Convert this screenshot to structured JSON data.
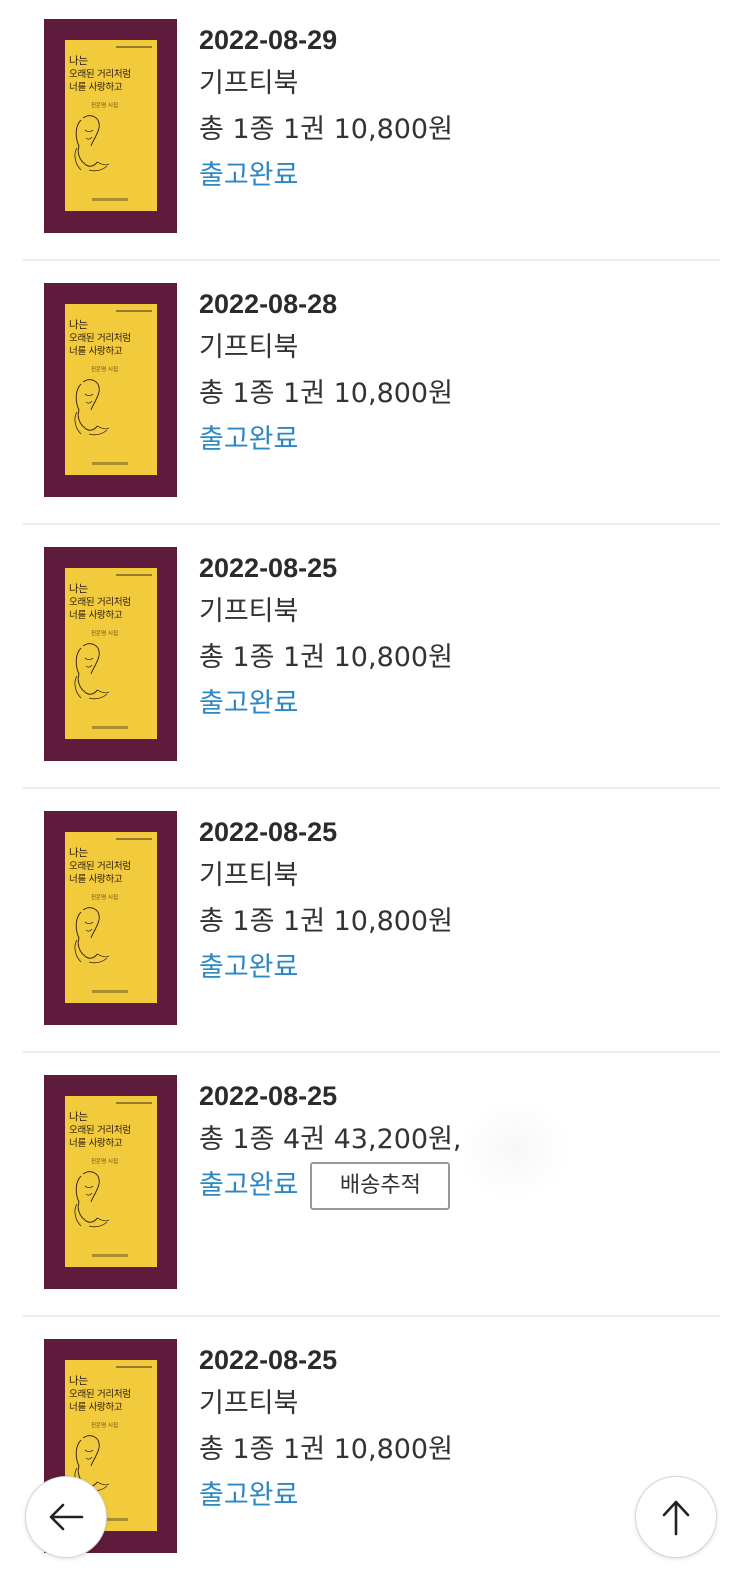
{
  "book": {
    "cover_title_line1": "나는",
    "cover_title_line2": "오래된 거리처럼",
    "cover_title_line3": "너를 사랑하고",
    "cover_author": "진은영 시집"
  },
  "orders": [
    {
      "date": "2022-08-29",
      "product": "기프티북",
      "summary": "총 1종 1권 10,800원",
      "status": "출고완료"
    },
    {
      "date": "2022-08-28",
      "product": "기프티북",
      "summary": "총 1종 1권 10,800원",
      "status": "출고완료"
    },
    {
      "date": "2022-08-25",
      "product": "기프티북",
      "summary": "총 1종 1권 10,800원",
      "status": "출고완료"
    },
    {
      "date": "2022-08-25",
      "product": "기프티북",
      "summary": "총 1종 1권 10,800원",
      "status": "출고완료"
    },
    {
      "date": "2022-08-25",
      "summary": "총 1종 4권 43,200원,",
      "status": "출고완료",
      "track_label": "배송추적"
    },
    {
      "date": "2022-08-25",
      "product": "기프티북",
      "summary": "총 1종 1권 10,800원",
      "status": "출고완료"
    }
  ],
  "nav": {
    "back_icon": "arrow-left-icon",
    "top_icon": "arrow-up-icon"
  },
  "colors": {
    "status": "#2d87c7",
    "cover_border": "#5e1b3c",
    "cover_fill": "#f2cb3c"
  }
}
